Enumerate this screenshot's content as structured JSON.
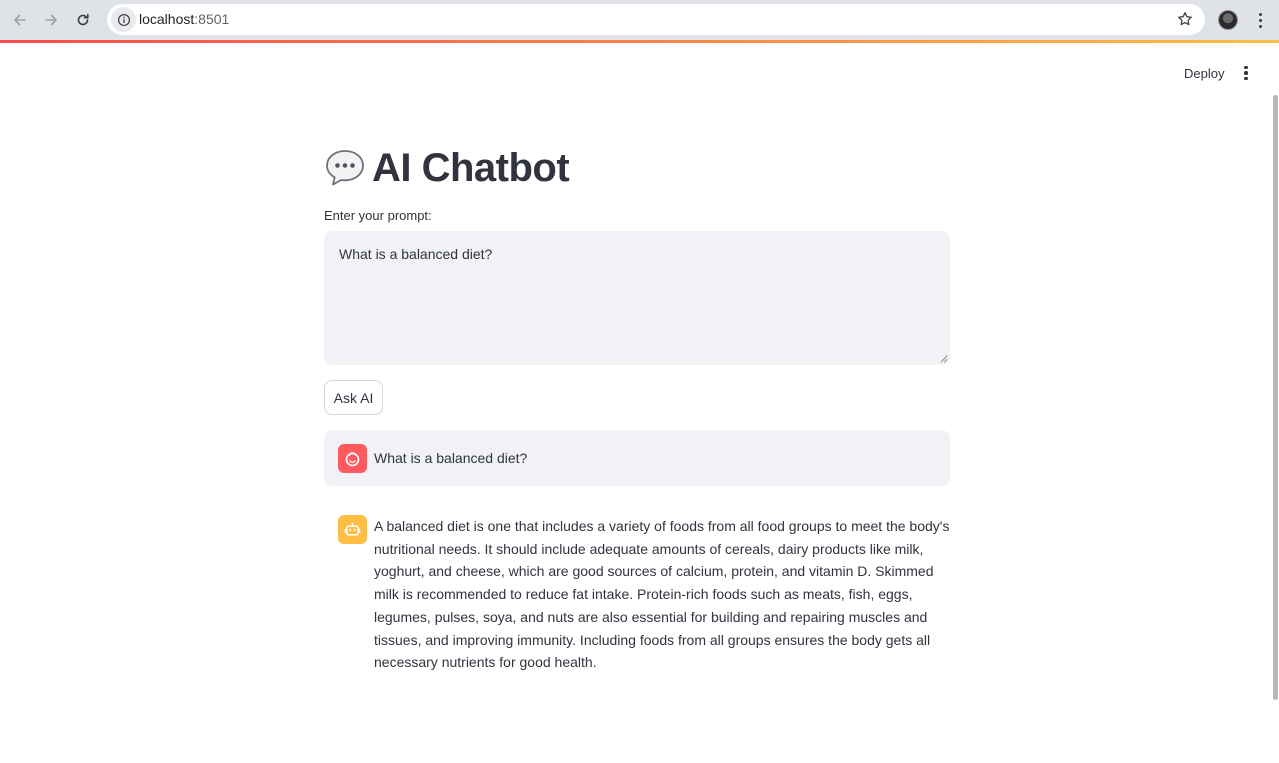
{
  "browser": {
    "url_host": "localhost",
    "url_port": ":8501"
  },
  "header": {
    "deploy_label": "Deploy"
  },
  "app": {
    "title": "AI Chatbot",
    "title_icon": "speech-balloon-icon",
    "prompt_label": "Enter your prompt:",
    "prompt_value": "What is a balanced diet?",
    "ask_button_label": "Ask AI"
  },
  "chat": {
    "messages": [
      {
        "role": "user",
        "avatar_icon": "user-face-icon",
        "avatar_color": "#ff5a5f",
        "text": "What is a balanced diet?"
      },
      {
        "role": "assistant",
        "avatar_icon": "robot-icon",
        "avatar_color": "#ffbd45",
        "text": "A balanced diet is one that includes a variety of foods from all food groups to meet the body's nutritional needs. It should include adequate amounts of cereals, dairy products like milk, yoghurt, and cheese, which are good sources of calcium, protein, and vitamin D. Skimmed milk is recommended to reduce fat intake. Protein-rich foods such as meats, fish, eggs, legumes, pulses, soya, and nuts are also essential for building and repairing muscles and tissues, and improving immunity. Including foods from all groups ensures the body gets all necessary nutrients for good health."
      }
    ]
  },
  "colors": {
    "accent_gradient_start": "#ff4b4b",
    "accent_gradient_end": "#ffbd45",
    "input_background": "#f0f2f6",
    "text": "#31333f"
  }
}
